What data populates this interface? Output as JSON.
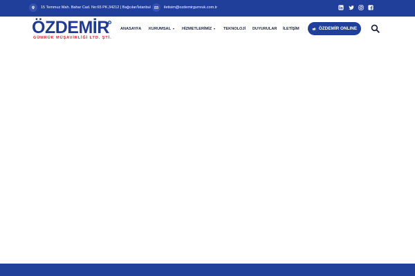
{
  "topbar": {
    "address": "15 Temmuz Mah. Bahar Cad. No:65 PK.34212 | Bağcılar/İstanbul",
    "email": "iletisim@ozdemirgumruk.com.tr",
    "icons": [
      "location-icon",
      "email-icon"
    ],
    "social": [
      "linkedin-icon",
      "twitter-icon",
      "instagram-icon",
      "facebook-icon"
    ],
    "color": "#1f3f9a"
  },
  "logo": {
    "main": "ÖZDEMİR",
    "sub": "GÜMRÜK MÜŞAVİRLİĞİ LTD. ŞTİ.",
    "reg": "R"
  },
  "nav": {
    "items": [
      {
        "label": "ANASAYFA",
        "dropdown": false
      },
      {
        "label": "KURUMSAL",
        "dropdown": true
      },
      {
        "label": "HİZMETLERİMİZ",
        "dropdown": true
      },
      {
        "label": "TEKNOLOJİ",
        "dropdown": false
      },
      {
        "label": "DUYURULAR",
        "dropdown": false
      },
      {
        "label": "İLETİŞİM",
        "dropdown": false
      }
    ],
    "cta_label": "ÖZDEMİR ONLINE",
    "cta_icon": "megaphone-icon",
    "search_icon": "search-icon"
  },
  "colors": {
    "brand_blue": "#1f3f9a",
    "brand_red": "#d42a2a",
    "nav_text": "#1b2140"
  }
}
